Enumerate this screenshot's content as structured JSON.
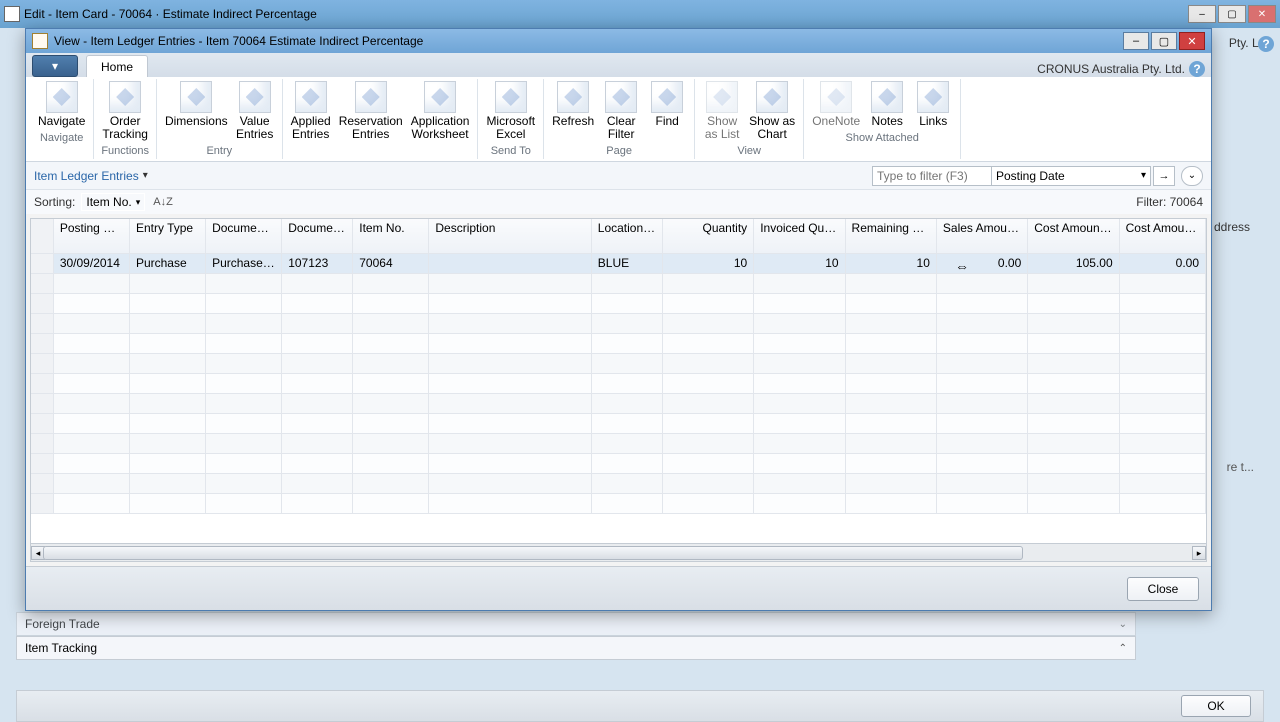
{
  "outer": {
    "title": "Edit - Item Card - 70064 · Estimate Indirect Percentage"
  },
  "modal": {
    "title": "View - Item Ledger Entries - Item 70064 Estimate Indirect Percentage",
    "company": "CRONUS Australia Pty. Ltd.",
    "close_btn": "Close"
  },
  "ribbon": {
    "tab_home": "Home",
    "groups": {
      "navigate": "Navigate",
      "functions": "Functions",
      "entry": "Entry",
      "sendto": "Send To",
      "page": "Page",
      "view": "View",
      "showattached": "Show Attached"
    },
    "items": {
      "navigate": "Navigate",
      "order_tracking": "Order\nTracking",
      "dimensions": "Dimensions",
      "value_entries": "Value\nEntries",
      "applied_entries": "Applied\nEntries",
      "reservation_entries": "Reservation\nEntries",
      "application_worksheet": "Application\nWorksheet",
      "ms_excel": "Microsoft\nExcel",
      "refresh": "Refresh",
      "clear_filter": "Clear\nFilter",
      "find": "Find",
      "show_as_list": "Show\nas List",
      "show_as_chart": "Show as\nChart",
      "onenote": "OneNote",
      "notes": "Notes",
      "links": "Links"
    }
  },
  "filterbar": {
    "title": "Item Ledger Entries",
    "placeholder": "Type to filter (F3)",
    "field": "Posting Date"
  },
  "sortbar": {
    "label": "Sorting:",
    "value": "Item No.",
    "filter": "Filter: 70064"
  },
  "grid": {
    "columns": [
      "Posting Date",
      "Entry Type",
      "Document Type",
      "Document No.",
      "Item No.",
      "Description",
      "Location Code",
      "Quantity",
      "Invoiced Quantity",
      "Remaining Quantity",
      "Sales Amount (Actual)",
      "Cost Amount (Actual)",
      "Cost Amount (Non-Invtbl.)"
    ],
    "rows": [
      {
        "posting_date": "30/09/2014",
        "entry_type": "Purchase",
        "doc_type": "Purchase R...",
        "doc_no": "107123",
        "item_no": "70064",
        "description": "",
        "loc": "BLUE",
        "qty": "10",
        "inv_qty": "10",
        "rem_qty": "10",
        "sales": "0.00",
        "cost": "105.00",
        "cost_ni": "0.00"
      }
    ]
  },
  "bg": {
    "foreign_trade": "Foreign Trade",
    "item_tracking": "Item Tracking",
    "ok": "OK",
    "company_suffix": "Pty. Ltd.",
    "address": "ddress",
    "re_t": "re t..."
  }
}
